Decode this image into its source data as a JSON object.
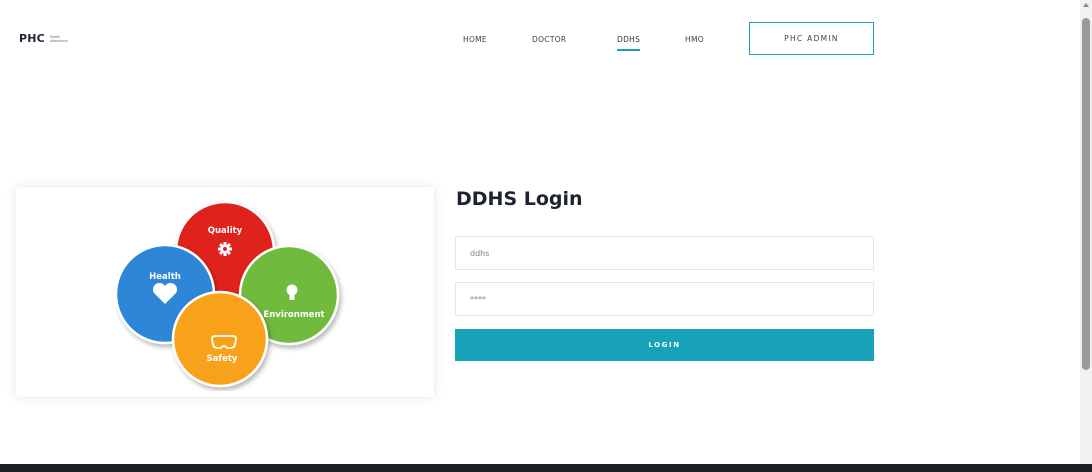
{
  "brand": {
    "logo_text": "PHC",
    "tagline_line1": "Health",
    "tagline_line2": "Attendance"
  },
  "nav": {
    "items": [
      {
        "label": "HOME"
      },
      {
        "label": "DOCTOR"
      },
      {
        "label": "DDHS",
        "active": true
      },
      {
        "label": "HMO"
      }
    ],
    "admin_button": "PHC ADMIN"
  },
  "illustration": {
    "circles": [
      {
        "label": "Quality",
        "color": "#e0241c",
        "icon": "gear-icon"
      },
      {
        "label": "Health",
        "color": "#2f86d7",
        "icon": "heart-icon"
      },
      {
        "label": "Environment",
        "color": "#6fba3e",
        "icon": "lightbulb-icon"
      },
      {
        "label": "Safety",
        "color": "#f8a21a",
        "icon": "goggles-icon"
      }
    ]
  },
  "login": {
    "title": "DDHS Login",
    "username_value": "ddhs",
    "password_value": "****",
    "button_label": "LOGIN"
  },
  "colors": {
    "accent": "#17a2b8",
    "footer": "#1c1f24"
  }
}
